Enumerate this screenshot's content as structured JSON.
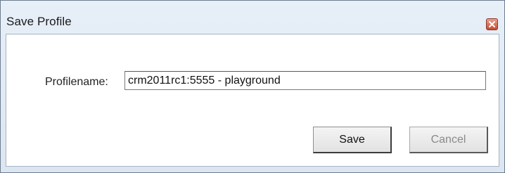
{
  "window": {
    "title": "Save Profile"
  },
  "form": {
    "profilename_label": "Profilename:",
    "profilename_value": "crm2011rc1:5555 - playground"
  },
  "buttons": {
    "save_label": "Save",
    "cancel_label": "Cancel"
  },
  "colors": {
    "titlebar_bg": "#dbe6f2",
    "close_button": "#c84a30"
  },
  "icons": {
    "close": "close-icon"
  }
}
